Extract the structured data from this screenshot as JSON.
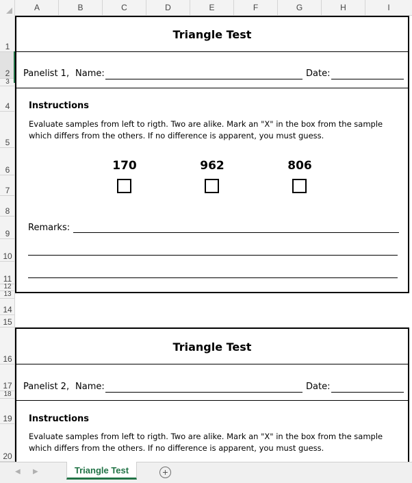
{
  "columns": [
    "A",
    "B",
    "C",
    "D",
    "E",
    "F",
    "G",
    "H",
    "I"
  ],
  "rows": [
    "1",
    "2",
    "3",
    "4",
    "5",
    "6",
    "7",
    "8",
    "9",
    "10",
    "11",
    "12",
    "13",
    "14",
    "15",
    "16",
    "17",
    "18",
    "19",
    "20"
  ],
  "form1": {
    "title": "Triangle Test",
    "panelist": "Panelist 1,",
    "name_label": "Name:",
    "date_label": "Date:",
    "instructions_heading": "Instructions",
    "instructions_text": "Evaluate samples from left to rigth. Two are alike. Mark an \"X\" in the box from the sample which differs from the others. If no difference is apparent, you must guess.",
    "samples": [
      "170",
      "962",
      "806"
    ],
    "remarks_label": "Remarks:"
  },
  "form2": {
    "title": "Triangle Test",
    "panelist": "Panelist 2,",
    "name_label": "Name:",
    "date_label": "Date:",
    "instructions_heading": "Instructions",
    "instructions_text": "Evaluate samples from left to rigth. Two are alike. Mark an \"X\" in the box from the sample which differs from the others. If no difference is apparent, you must guess."
  },
  "tabs": {
    "active_sheet": "Triangle Test",
    "add_sheet_icon": "plus-circle-icon",
    "accent_color": "#217346"
  }
}
